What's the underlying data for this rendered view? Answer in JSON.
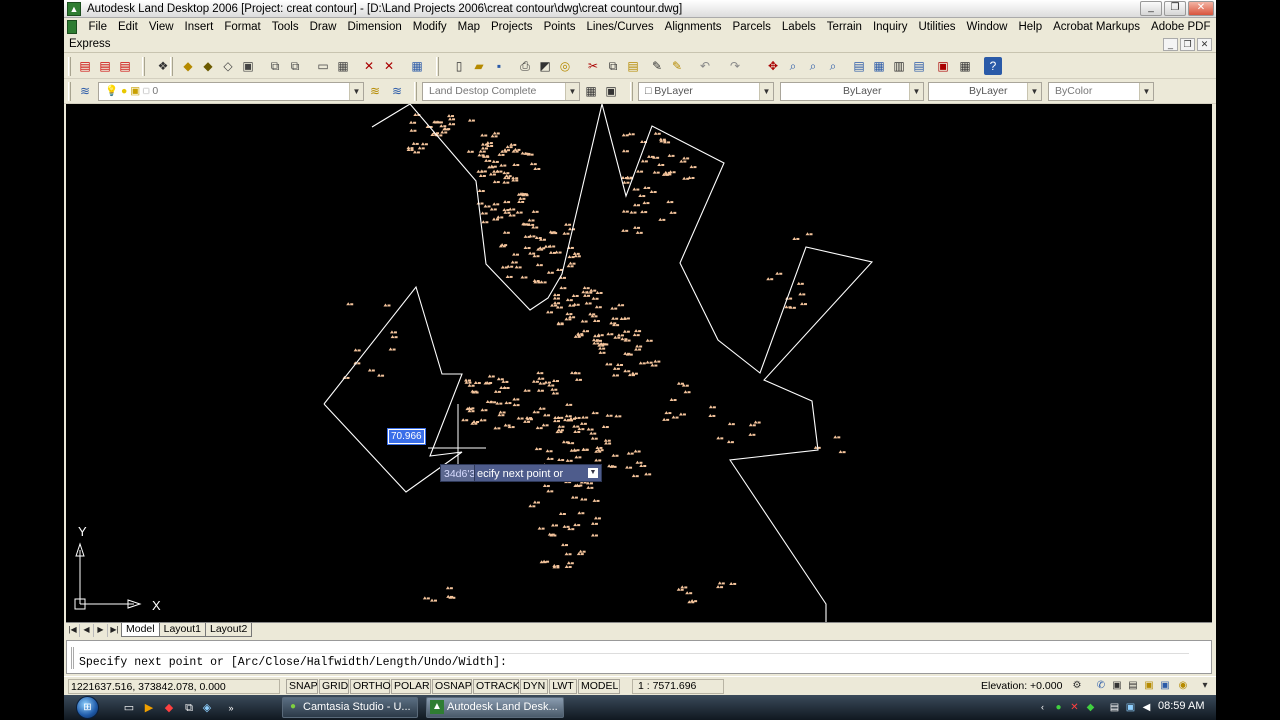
{
  "window": {
    "title": "Autodesk Land Desktop 2006 [Project: creat contour] - [D:\\Land Projects 2006\\creat contour\\dwg\\creat countour.dwg]",
    "buttons": [
      "minimize-icon",
      "restore-icon",
      "close-icon"
    ]
  },
  "menu": {
    "items": [
      "File",
      "Edit",
      "View",
      "Insert",
      "Format",
      "Tools",
      "Draw",
      "Dimension",
      "Modify",
      "Map",
      "Projects",
      "Points",
      "Lines/Curves",
      "Alignments",
      "Parcels",
      "Labels",
      "Terrain",
      "Inquiry",
      "Utilities",
      "Window",
      "Help",
      "Acrobat Markups",
      "Adobe PDF"
    ],
    "second_row": [
      "Express"
    ]
  },
  "toolbar2": {
    "layer_name": "0",
    "layer_state": "Land Destop Complete",
    "color": "ByLayer",
    "linetype": "ByLayer",
    "lineweight": "ByLayer",
    "plotstyle": "ByColor"
  },
  "drawing": {
    "dynamic_input_value": "70.966",
    "dynamic_angle": "34d6'3",
    "dynamic_prompt": "ecify next point or",
    "ucs_x": "X",
    "ucs_y": "Y",
    "colors": {
      "background": "#000000",
      "boundary": "#ffffff",
      "points": "#f4c49c",
      "selection": "#3a6ee8"
    }
  },
  "tabs": {
    "items": [
      "Model",
      "Layout1",
      "Layout2"
    ],
    "active": "Model"
  },
  "command": {
    "prompt": "Specify next point or [Arc/Close/Halfwidth/Length/Undo/Width]:"
  },
  "status": {
    "coordinates": "1221637.516, 373842.078, 0.000",
    "toggles": [
      "SNAP",
      "GRID",
      "ORTHO",
      "POLAR",
      "OSNAP",
      "OTRACK",
      "DYN",
      "LWT",
      "MODEL"
    ],
    "scale": "1 : 7571.696",
    "elevation_label": "Elevation:",
    "elevation_value": "+0.000"
  },
  "taskbar": {
    "tasks": [
      {
        "label": "Camtasia Studio - U...",
        "icon": "camtasia-icon"
      },
      {
        "label": "Autodesk Land Desk...",
        "icon": "land-desktop-icon"
      }
    ],
    "clock": "08:59 AM"
  }
}
